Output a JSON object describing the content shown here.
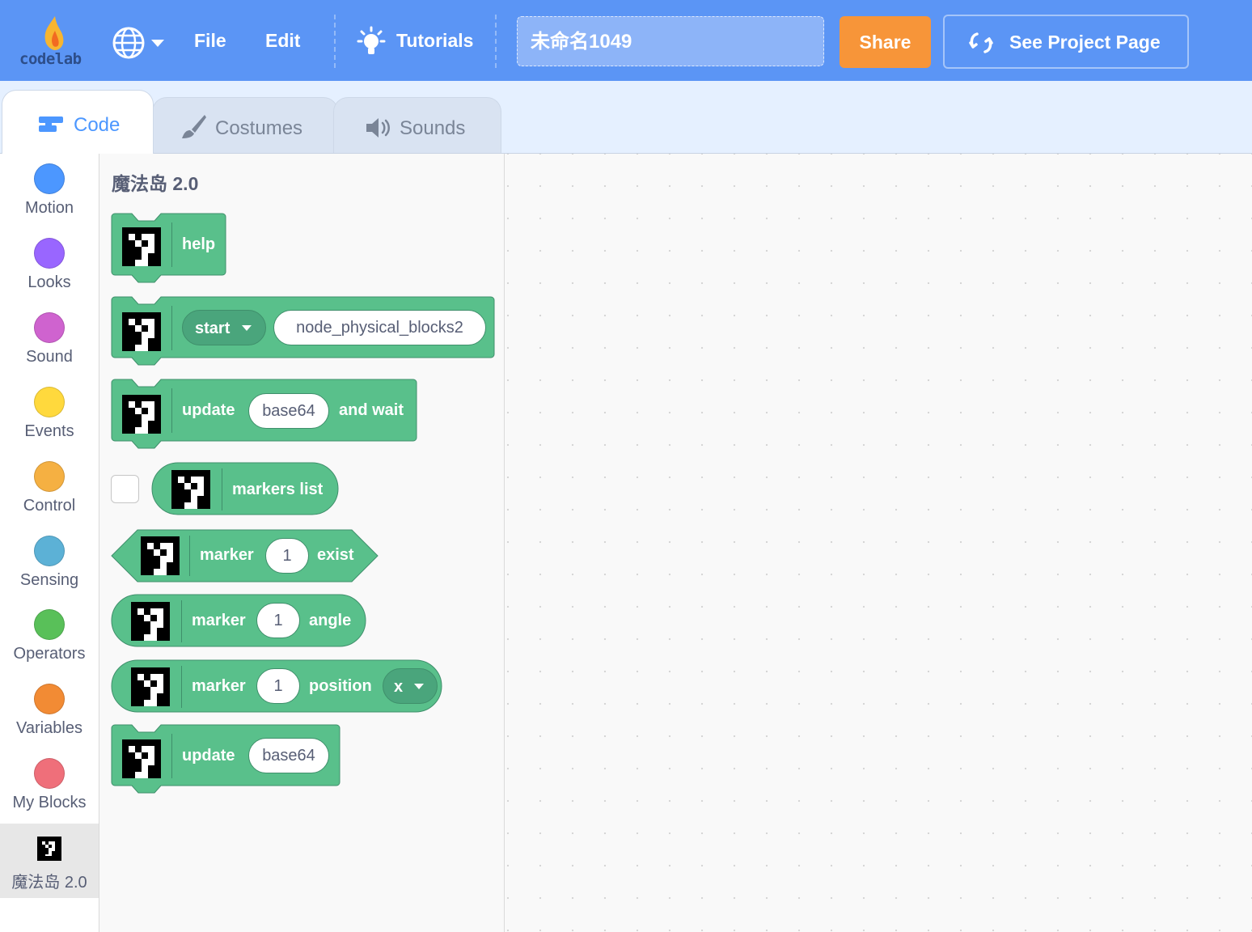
{
  "menubar": {
    "logo_text": "codelab",
    "file_label": "File",
    "edit_label": "Edit",
    "tutorials_label": "Tutorials",
    "project_title": "未命名1049",
    "share_label": "Share",
    "see_project_label": "See Project Page"
  },
  "tabs": {
    "code_label": "Code",
    "costumes_label": "Costumes",
    "sounds_label": "Sounds"
  },
  "categories": [
    {
      "label": "Motion",
      "color": "#4c97ff"
    },
    {
      "label": "Looks",
      "color": "#9966ff"
    },
    {
      "label": "Sound",
      "color": "#cf63cf"
    },
    {
      "label": "Events",
      "color": "#ffd93d"
    },
    {
      "label": "Control",
      "color": "#f5b042"
    },
    {
      "label": "Sensing",
      "color": "#5cb1d6"
    },
    {
      "label": "Operators",
      "color": "#59c059"
    },
    {
      "label": "Variables",
      "color": "#f28b34"
    },
    {
      "label": "My Blocks",
      "color": "#ef6f7a"
    },
    {
      "label": "魔法岛 2.0",
      "color": "#000000",
      "selected": true
    }
  ],
  "flyout": {
    "title": "魔法岛 2.0",
    "block_color": "#59c08b",
    "block_border": "#3f8f6b",
    "help": {
      "label": "help"
    },
    "start": {
      "dropdown": "start",
      "input": "node_physical_blocks2"
    },
    "update_wait": {
      "label": "update",
      "input": "base64",
      "suffix": "and wait"
    },
    "markers_list": {
      "label": "markers list",
      "checked": false
    },
    "marker_exist": {
      "label": "marker",
      "input": "1",
      "suffix": "exist"
    },
    "marker_angle": {
      "label": "marker",
      "input": "1",
      "suffix": "angle"
    },
    "marker_position": {
      "label": "marker",
      "input": "1",
      "suffix": "position",
      "dropdown": "x"
    },
    "update": {
      "label": "update",
      "input": "base64"
    }
  }
}
